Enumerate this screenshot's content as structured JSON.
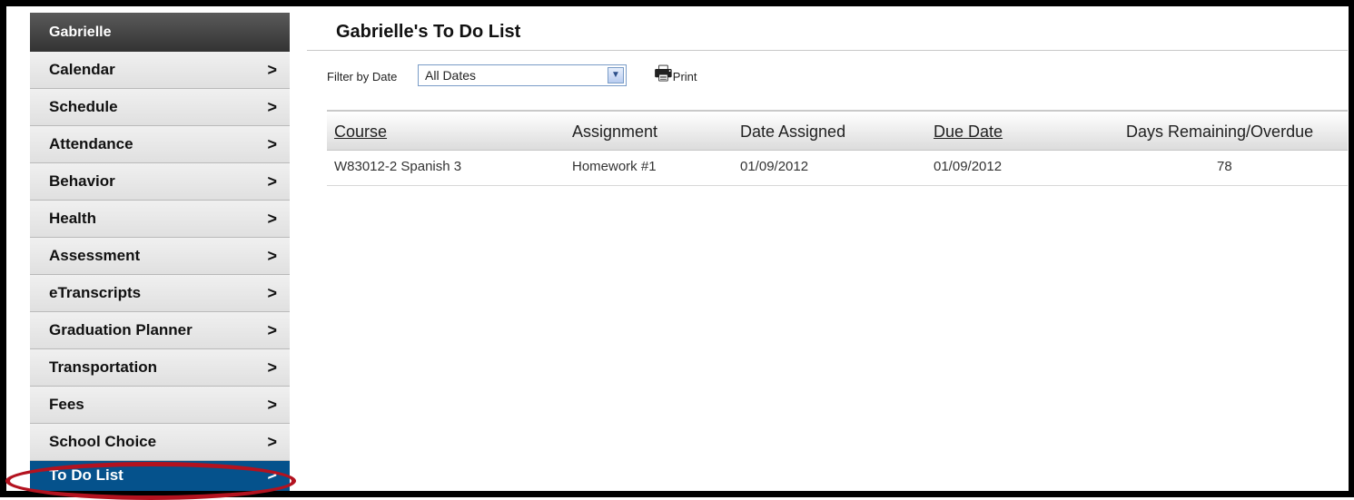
{
  "sidebar": {
    "header": "Gabrielle",
    "chevron": ">",
    "items": [
      {
        "label": "Calendar"
      },
      {
        "label": "Schedule"
      },
      {
        "label": "Attendance"
      },
      {
        "label": "Behavior"
      },
      {
        "label": "Health"
      },
      {
        "label": "Assessment"
      },
      {
        "label": "eTranscripts"
      },
      {
        "label": "Graduation Planner"
      },
      {
        "label": "Transportation"
      },
      {
        "label": "Fees"
      },
      {
        "label": "School Choice"
      },
      {
        "label": "To Do List",
        "active": true
      }
    ]
  },
  "main": {
    "title": "Gabrielle's To Do List",
    "filter": {
      "label": "Filter by Date",
      "selected": "All Dates"
    },
    "print_label": "Print",
    "table": {
      "headers": [
        "Course",
        "Assignment",
        "Date Assigned",
        "Due Date",
        "Days Remaining/Overdue"
      ],
      "rows": [
        [
          "W83012-2 Spanish 3",
          "Homework #1",
          "01/09/2012",
          "01/09/2012",
          "78"
        ]
      ]
    }
  },
  "colors": {
    "active_nav": "#05528c",
    "highlight_oval": "#b3121f"
  },
  "icons": {
    "printer": "printer-icon",
    "dropdown": "chevron-down-icon",
    "nav_chevron": "chevron-right-icon"
  }
}
